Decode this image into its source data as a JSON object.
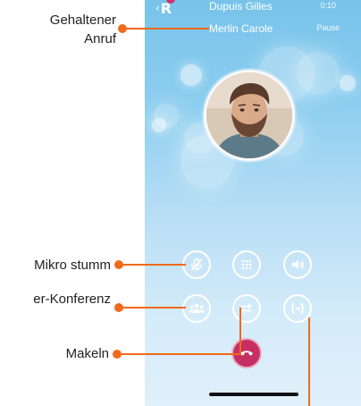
{
  "phone": {
    "caller_active": "Dupuis Gilles",
    "call_timer": "0:10",
    "caller_on_hold": "Merlin Carole",
    "hold_status": "Pause",
    "logo_letter": "R"
  },
  "controls": {
    "mute": "mute-microphone",
    "dialpad": "dialpad",
    "speaker": "speaker",
    "conference": "conference",
    "swap": "swap-calls",
    "transfer": "transfer-call",
    "hangup": "hang-up"
  },
  "callouts": {
    "held_call_line1": "Gehaltener",
    "held_call_line2": "Anruf",
    "mute_label": "Mikro stumm",
    "conference_label": "er-Konferenz",
    "swap_label": "Makeln"
  },
  "colors": {
    "accent_orange": "#ef6a1c",
    "hangup_pink": "#c62f63",
    "sky_blue": "#77c3ea"
  }
}
